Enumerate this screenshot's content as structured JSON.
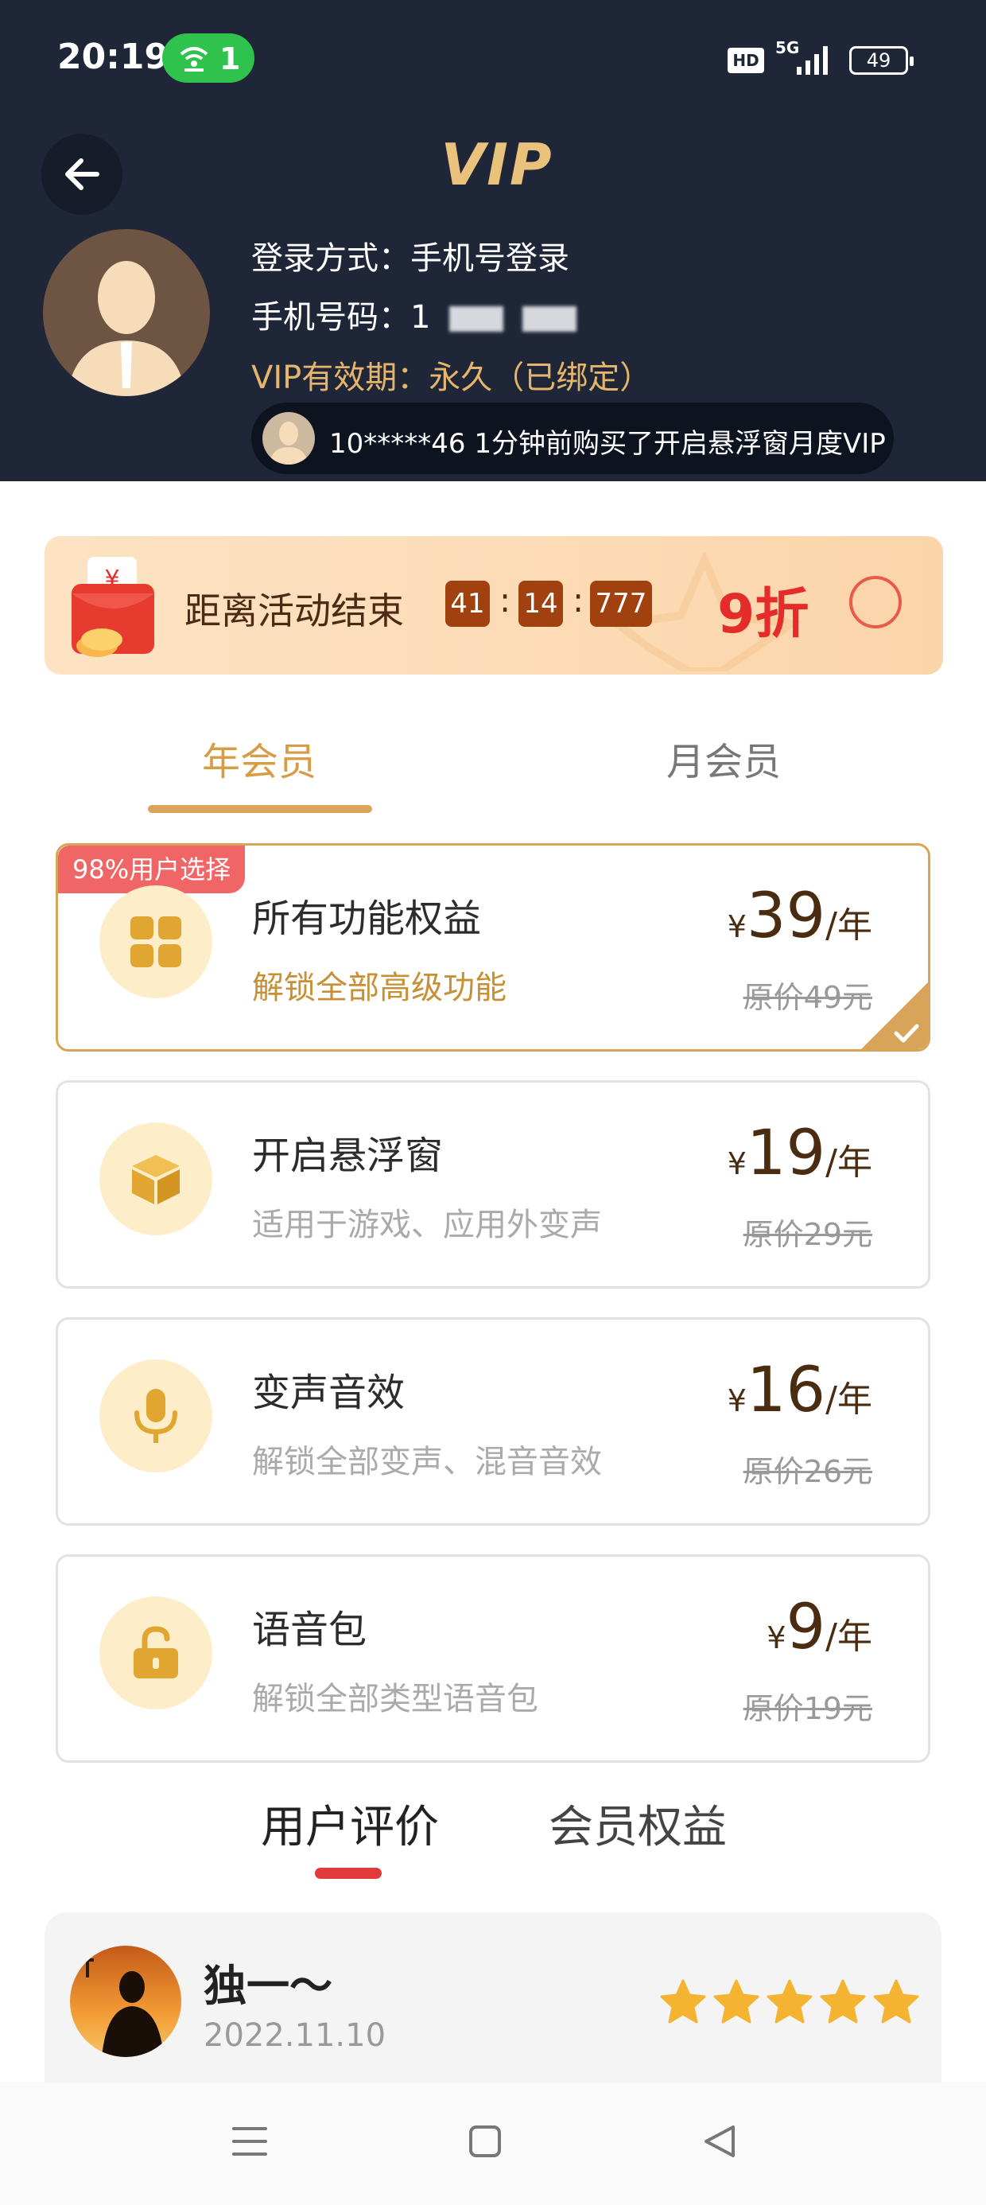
{
  "status_bar": {
    "time": "20:19",
    "hotspot_count": "1",
    "hd_badge": "HD",
    "network": "5G",
    "battery": "49"
  },
  "header": {
    "title": "VIP",
    "login_method": "登录方式：手机号登录",
    "phone_label": "手机号码：1",
    "vip_validity_label": "VIP有效期：",
    "vip_validity_value": "永久（已绑定）",
    "ticker_text": "10*****46 1分钟前购买了开启悬浮窗月度VIP"
  },
  "promo": {
    "label": "距离活动结束",
    "hours": "41",
    "minutes": "14",
    "millis": "777",
    "discount": "9折"
  },
  "tabs": [
    {
      "label": "年会员",
      "active": true
    },
    {
      "label": "月会员",
      "active": false
    }
  ],
  "plans": [
    {
      "badge": "98%用户选择",
      "title": "所有功能权益",
      "subtitle": "解锁全部高级功能",
      "currency": "¥",
      "price": "39",
      "unit": "/年",
      "original": "原价49元",
      "icon": "grid-icon",
      "selected": true
    },
    {
      "title": "开启悬浮窗",
      "subtitle": "适用于游戏、应用外变声",
      "currency": "¥",
      "price": "19",
      "unit": "/年",
      "original": "原价29元",
      "icon": "box-icon",
      "selected": false
    },
    {
      "title": "变声音效",
      "subtitle": "解锁全部变声、混音音效",
      "currency": "¥",
      "price": "16",
      "unit": "/年",
      "original": "原价26元",
      "icon": "microphone-icon",
      "selected": false
    },
    {
      "title": "语音包",
      "subtitle": "解锁全部类型语音包",
      "currency": "¥",
      "price": "9",
      "unit": "/年",
      "original": "原价19元",
      "icon": "unlock-icon",
      "selected": false
    }
  ],
  "section_tabs": [
    {
      "label": "用户评价",
      "active": true
    },
    {
      "label": "会员权益",
      "active": false
    }
  ],
  "review": {
    "name": "独一～",
    "date": "2022.11.10",
    "rating": 5
  },
  "colors": {
    "header_bg": "#1f2638",
    "gold": "#e4b56a",
    "accent_red": "#e62b2b",
    "card_selected_border": "#d8a45a"
  }
}
